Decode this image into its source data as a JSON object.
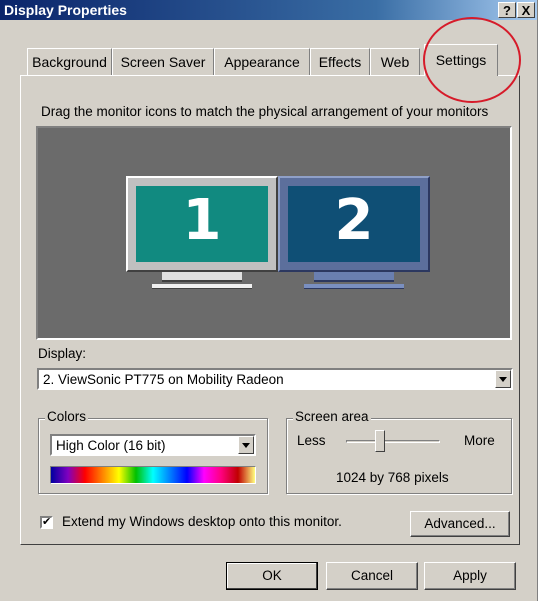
{
  "window": {
    "title": "Display Properties",
    "help_button": "?",
    "close_button": "X"
  },
  "tabs": [
    {
      "label": "Background"
    },
    {
      "label": "Screen Saver"
    },
    {
      "label": "Appearance"
    },
    {
      "label": "Effects"
    },
    {
      "label": "Web"
    },
    {
      "label": "Settings",
      "active": true
    }
  ],
  "instructions": "Drag the monitor icons to match the physical arrangement of your monitors",
  "monitors": [
    {
      "number": "1",
      "color": "#118a80"
    },
    {
      "number": "2",
      "color": "#0f4f75"
    }
  ],
  "display": {
    "label": "Display:",
    "value": "2. ViewSonic PT775 on Mobility Radeon"
  },
  "colors": {
    "group_label": "Colors",
    "value": "High Color (16 bit)"
  },
  "screen_area": {
    "group_label": "Screen area",
    "less_label": "Less",
    "more_label": "More",
    "resolution": "1024 by 768 pixels",
    "slider_level": 0.35
  },
  "extend_checkbox": {
    "label": "Extend my Windows desktop onto this monitor.",
    "checked": true,
    "mark": "✔"
  },
  "buttons": {
    "advanced": "Advanced...",
    "ok": "OK",
    "cancel": "Cancel",
    "apply": "Apply"
  },
  "highlight_color": "#d61b2a"
}
